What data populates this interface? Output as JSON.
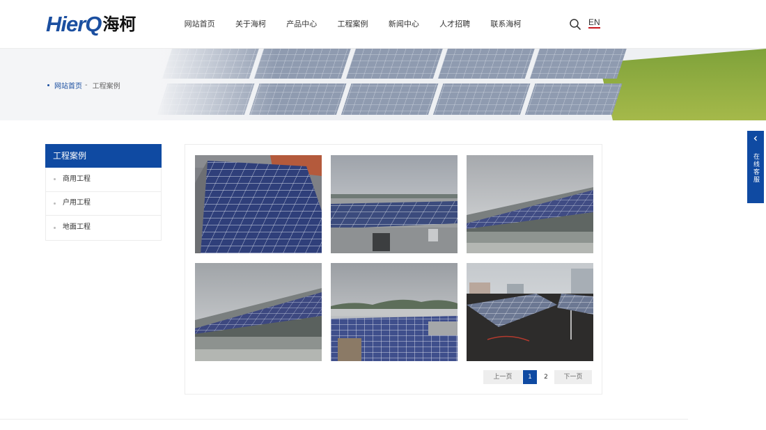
{
  "header": {
    "logo_latin": "HierQ",
    "logo_cn": "海柯",
    "nav": [
      "网站首页",
      "关于海柯",
      "产品中心",
      "工程案例",
      "新闻中心",
      "人才招聘",
      "联系海柯"
    ],
    "lang": "EN",
    "search_icon": "search-icon"
  },
  "breadcrumb": {
    "home": "网站首页",
    "separator": "-",
    "current": "工程案例"
  },
  "sidebar": {
    "title": "工程案例",
    "items": [
      "商用工程",
      "户用工程",
      "地面工程"
    ]
  },
  "gallery": {
    "items": [
      {
        "scene": "rooftop-panels-closeup"
      },
      {
        "scene": "rooftop-low-tilt-overcast"
      },
      {
        "scene": "rooftop-tilted-row"
      },
      {
        "scene": "rooftop-tilted-row-2"
      },
      {
        "scene": "rooftop-array-hills"
      },
      {
        "scene": "rooftop-frames-dark-roof"
      }
    ]
  },
  "pagination": {
    "prev": "上一页",
    "pages": [
      "1",
      "2"
    ],
    "current": "1",
    "next": "下一页"
  },
  "service": {
    "label": "在线客服"
  },
  "colors": {
    "brand_blue": "#0f4aa2",
    "accent_red": "#c8161d"
  }
}
